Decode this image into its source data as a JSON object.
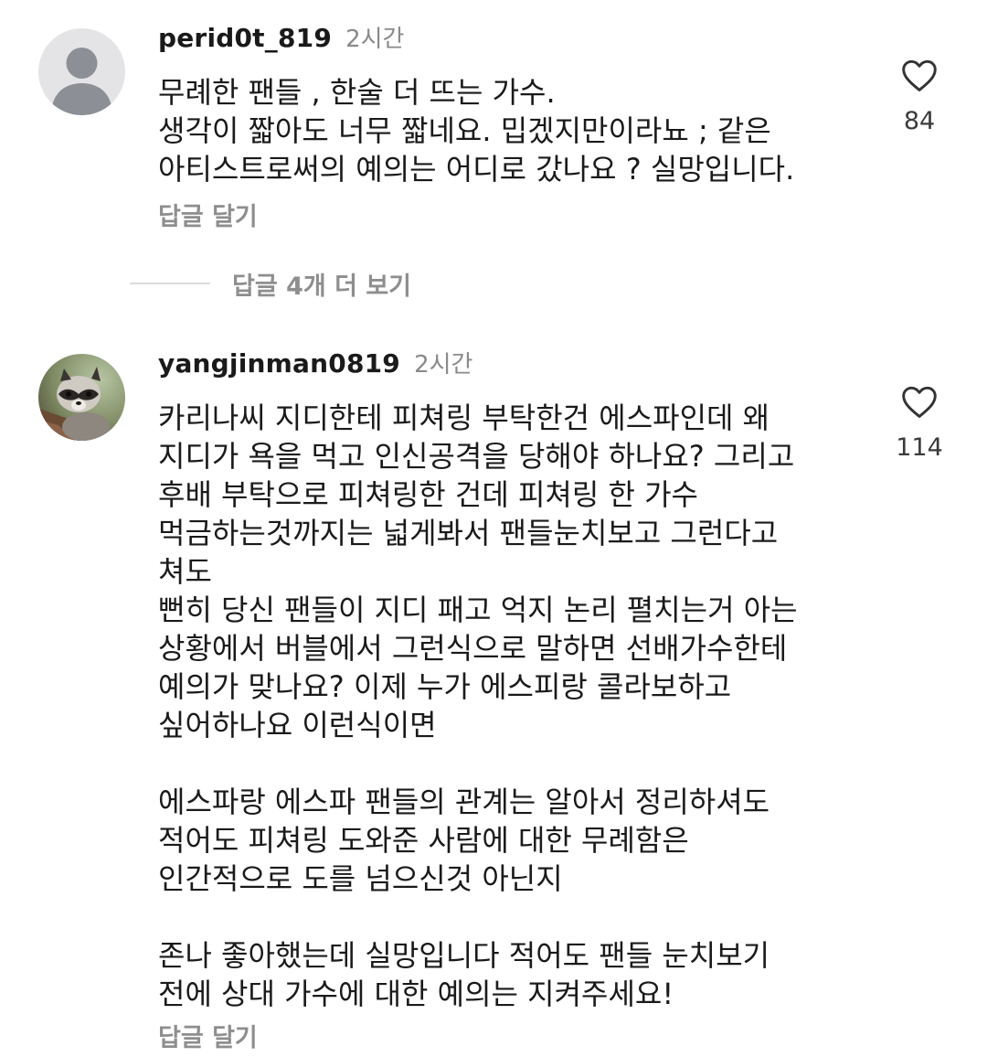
{
  "comments": [
    {
      "username": "perid0t_819",
      "time": "2시간",
      "text": "무례한 팬들 , 한술 더 뜨는 가수.\n생각이 짧아도 너무 짧네요. 밉겠지만이라뇨 ; 같은\n아티스트로써의 예의는 어디로 갔나요 ? 실망입니다.",
      "reply_label": "답글 달기",
      "likes": "84",
      "avatar_icon": "default-person-avatar"
    },
    {
      "username": "yangjinman0819",
      "time": "2시간",
      "text": "카리나씨 지디한테 피쳐링 부탁한건 에스파인데 왜\n지디가 욕을 먹고 인신공격을 당해야 하나요? 그리고\n후배 부탁으로 피쳐링한 건데 피쳐링 한 가수\n먹금하는것까지는 넓게봐서 팬들눈치보고 그런다고\n쳐도\n뻔히 당신 팬들이 지디 패고 억지 논리 펼치는거 아는\n상황에서 버블에서 그런식으로 말하면 선배가수한테\n예의가 맞나요? 이제 누가 에스피랑 콜라보하고\n싶어하나요 이런식이면\n\n에스파랑 에스파 팬들의 관계는 알아서 정리하셔도\n적어도 피쳐링 도와준 사람에 대한 무례함은\n인간적으로 도를 넘으신것 아닌지\n\n존나 좋아했는데 실망입니다 적어도 팬들 눈치보기\n전에 상대 가수에 대한 예의는 지켜주세요!",
      "reply_label": "답글 달기",
      "likes": "114",
      "avatar_icon": "raccoon-avatar"
    }
  ],
  "view_more_replies": "답글 4개 더 보기",
  "colors": {
    "text": "#1a1a1a",
    "muted": "#8e8e8e",
    "divider": "#dcdcdc",
    "default_avatar_bg": "#e4e4e7",
    "default_avatar_fg": "#8c8f96"
  }
}
